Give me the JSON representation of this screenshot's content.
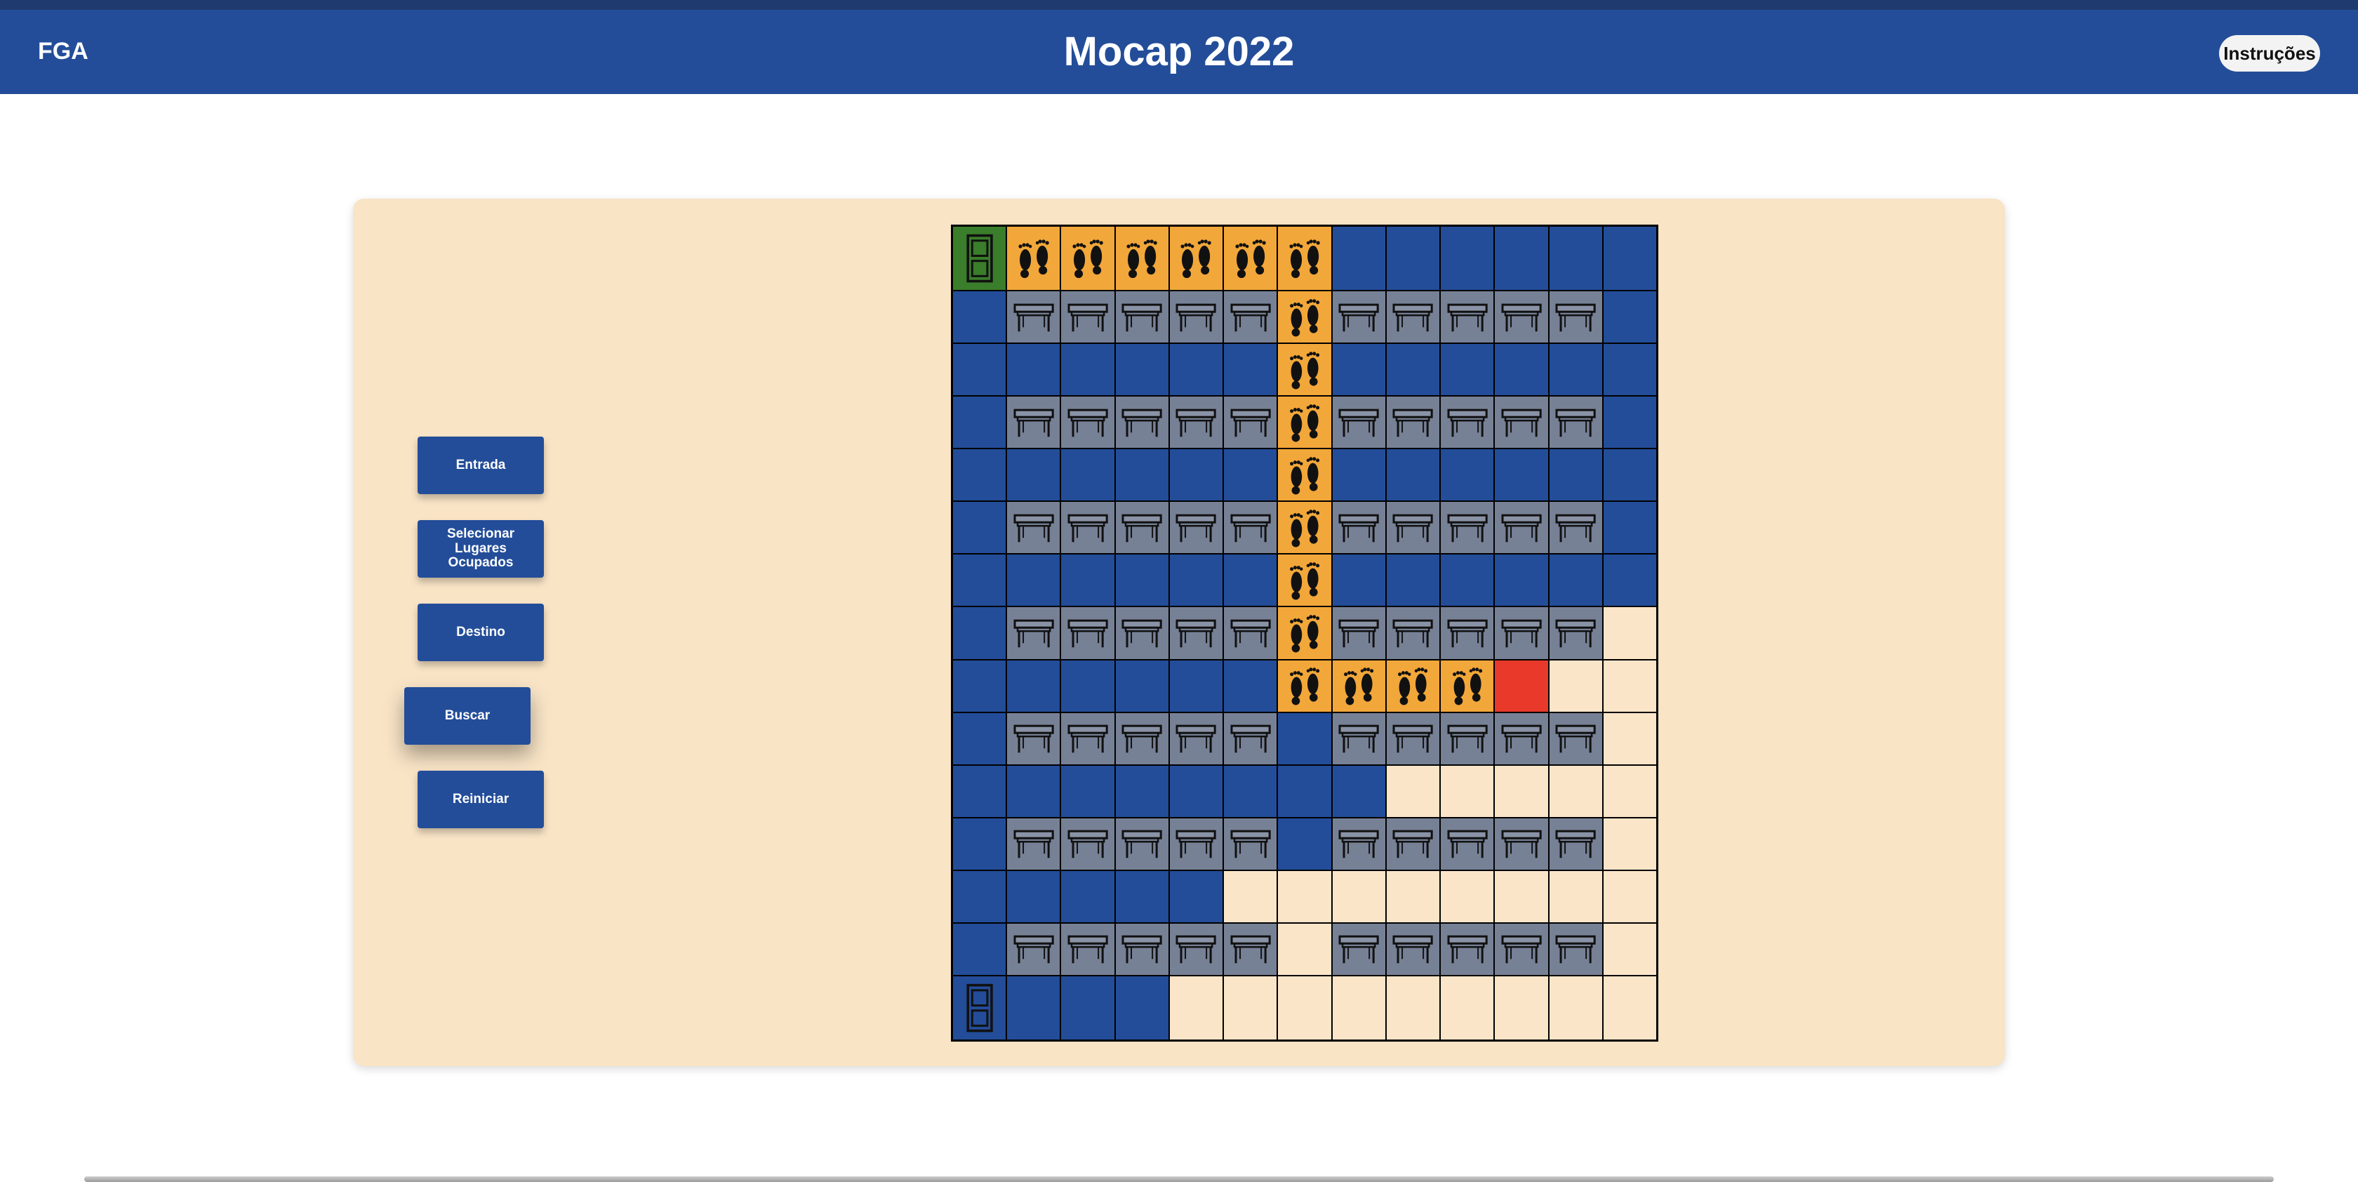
{
  "header": {
    "brand": "FGA",
    "title": "Mocap 2022",
    "help_label": "Instruções"
  },
  "sidebar": {
    "entrada": "Entrada",
    "selecionar": [
      "Selecionar",
      "Lugares",
      "Ocupados"
    ],
    "destino": "Destino",
    "buscar": "Buscar",
    "reiniciar": "Reiniciar"
  },
  "colors": {
    "header": "#234d99",
    "floor": "#234d99",
    "panel": "#f9e4c6",
    "desk": "#778196",
    "path": "#f2a73a",
    "destination": "#e8392b",
    "entry": "#3a7d2a"
  },
  "grid": {
    "cols": 13,
    "rows": 15,
    "legend": {
      "F": "floor",
      "E": "empty",
      "D": "desk",
      "P": "path",
      "X": "destination",
      "N": "entry-door",
      "K": "exit-door"
    },
    "map": [
      "NPPPPPPFFFFFF",
      "FDDDDDPDDDDDF",
      "FFFFFFPFFFFFF",
      "FDDDDDPDDDDDF",
      "FFFFFFPFFFFFF",
      "FDDDDDPDDDDDF",
      "FFFFFFPFFFFFF",
      "FDDDDDPDDDDDE",
      "FFFFFFPPPPXEE",
      "FDDDDDFDDDDDE",
      "FFFFFFFFEEEEE",
      "FDDDDDFDDDDDE",
      "FFFFFEEEEEEEE",
      "FDDDDDEDDDDDE",
      "KFFFEEEEEEEEE"
    ]
  }
}
